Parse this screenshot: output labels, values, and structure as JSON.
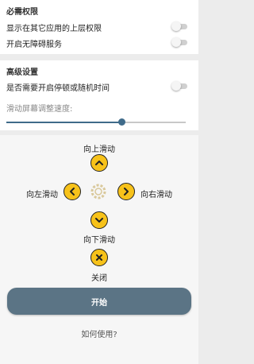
{
  "permissions": {
    "title": "必需权限",
    "items": [
      {
        "label": "显示在其它应用的上层权限",
        "enabled": false
      },
      {
        "label": "开启无障碍服务",
        "enabled": false
      }
    ]
  },
  "advanced": {
    "title": "高级设置",
    "items": [
      {
        "label": "是否需要开启停顿或随机时间",
        "enabled": false
      }
    ],
    "slider_label": "滑动屏幕调整速度:",
    "slider_value": 0.64
  },
  "controls": {
    "up_label": "向上滑动",
    "left_label": "向左滑动",
    "right_label": "向右滑动",
    "down_label": "向下滑动",
    "close_label": "关闭",
    "accent_color": "#f7c21a"
  },
  "actions": {
    "start_label": "开始",
    "help_label": "如何使用?"
  }
}
